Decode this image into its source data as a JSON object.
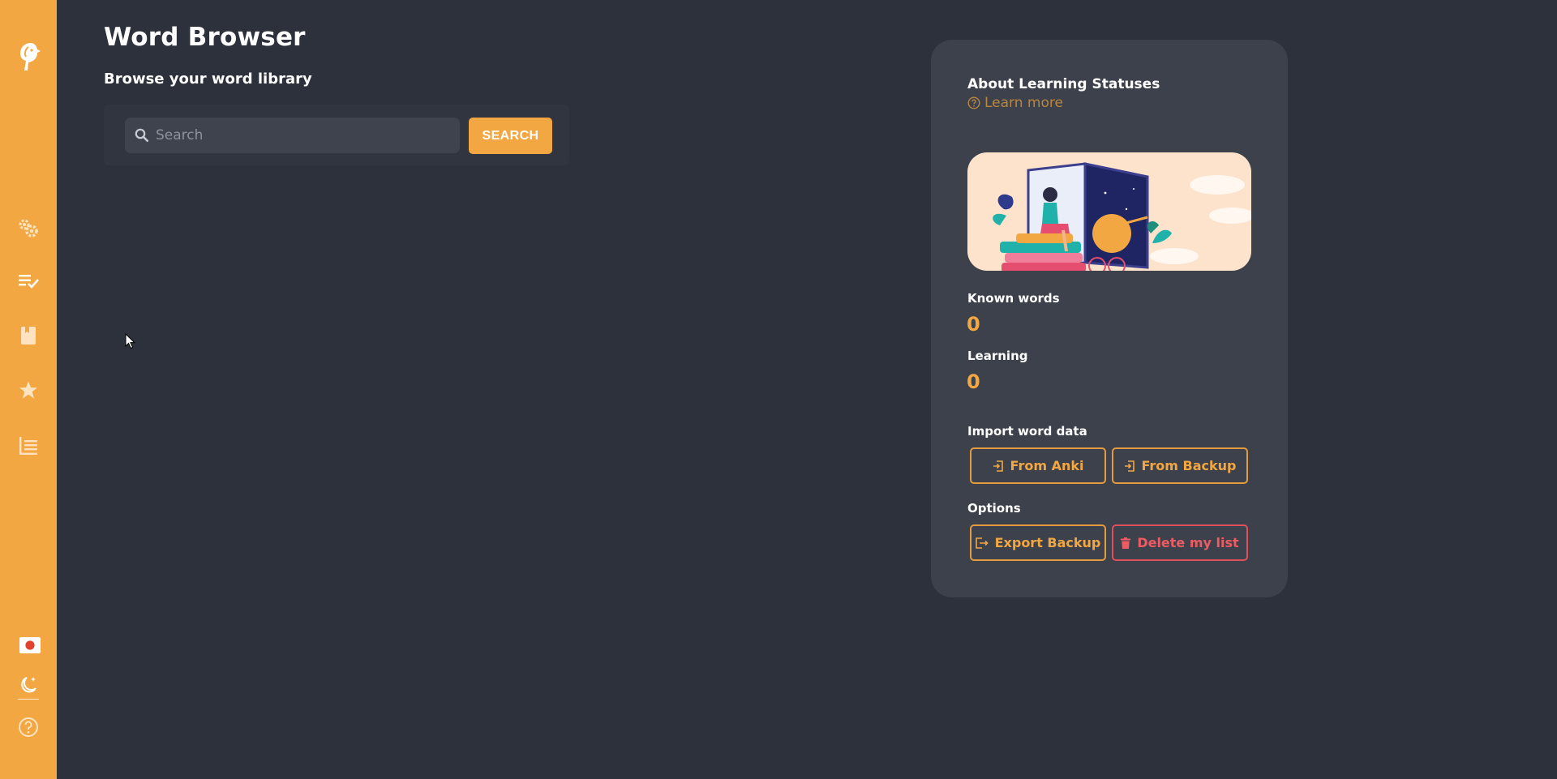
{
  "header": {
    "title": "Word Browser",
    "subtitle": "Browse your word library"
  },
  "search": {
    "placeholder": "Search",
    "value": "",
    "button_label": "SEARCH"
  },
  "sidebar": {
    "logo_icon": "bird-logo-icon",
    "items": [
      {
        "icon": "settings-gears-icon"
      },
      {
        "icon": "checklist-icon"
      },
      {
        "icon": "book-icon"
      },
      {
        "icon": "star-icon"
      },
      {
        "icon": "list-icon"
      }
    ],
    "bottom": [
      {
        "icon": "japan-flag-icon"
      },
      {
        "icon": "dark-mode-icon"
      },
      {
        "icon": "help-icon"
      }
    ]
  },
  "info_card": {
    "title": "About Learning Statuses",
    "learn_more": "Learn more",
    "known_words_label": "Known words",
    "known_words_count": "0",
    "learning_label": "Learning",
    "learning_count": "0",
    "import_label": "Import word data",
    "from_anki": "From Anki",
    "from_backup": "From Backup",
    "options_label": "Options",
    "export_backup": "Export Backup",
    "delete_list": "Delete my list"
  },
  "colors": {
    "accent": "#f2a742",
    "background": "#2d313b",
    "card": "#3d414c",
    "danger": "#ee5b63"
  }
}
